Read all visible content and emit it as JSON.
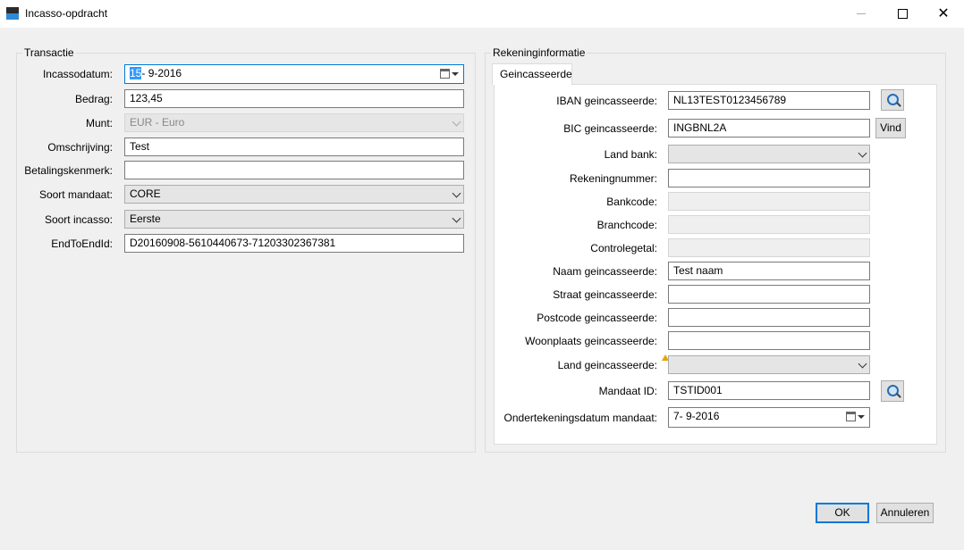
{
  "window": {
    "title": "Incasso-opdracht"
  },
  "transactie": {
    "group_title": "Transactie",
    "incassodatum": {
      "label": "Incassodatum:",
      "day_selected": "15",
      "rest": "-  9-2016"
    },
    "bedrag": {
      "label": "Bedrag:",
      "value": "123,45"
    },
    "munt": {
      "label": "Munt:",
      "value": "EUR - Euro"
    },
    "omschrijving": {
      "label": "Omschrijving:",
      "value": "Test"
    },
    "betalingskenmerk": {
      "label": "Betalingskenmerk:",
      "value": ""
    },
    "soort_mandaat": {
      "label": "Soort mandaat:",
      "value": "CORE"
    },
    "soort_incasso": {
      "label": "Soort incasso:",
      "value": "Eerste"
    },
    "endtoendid": {
      "label": "EndToEndId:",
      "value": "D20160908-5610440673-71203302367381"
    }
  },
  "rekening": {
    "group_title": "Rekeninginformatie",
    "tab": "Geincasseerde",
    "iban": {
      "label": "IBAN geincasseerde:",
      "value": "NL13TEST0123456789"
    },
    "bic": {
      "label": "BIC geincasseerde:",
      "value": "INGBNL2A"
    },
    "vind_button": "Vind",
    "land_bank": {
      "label": "Land bank:",
      "value": ""
    },
    "rekeningnummer": {
      "label": "Rekeningnummer:",
      "value": ""
    },
    "bankcode": {
      "label": "Bankcode:",
      "value": ""
    },
    "branchcode": {
      "label": "Branchcode:",
      "value": ""
    },
    "controlegetal": {
      "label": "Controlegetal:",
      "value": ""
    },
    "naam": {
      "label": "Naam geincasseerde:",
      "value": "Test naam"
    },
    "straat": {
      "label": "Straat geincasseerde:",
      "value": ""
    },
    "postcode": {
      "label": "Postcode geincasseerde:",
      "value": ""
    },
    "woonplaats": {
      "label": "Woonplaats geincasseerde:",
      "value": ""
    },
    "land": {
      "label": "Land geincasseerde:",
      "value": ""
    },
    "mandaat_id": {
      "label": "Mandaat ID:",
      "value": "TSTID001"
    },
    "ondertekeningsdatum": {
      "label": "Ondertekeningsdatum mandaat:",
      "value": "7-  9-2016"
    }
  },
  "footer": {
    "ok": "OK",
    "annuleren": "Annuleren"
  },
  "colors": {
    "accent": "#0078d7",
    "warning": "#e6a400"
  }
}
